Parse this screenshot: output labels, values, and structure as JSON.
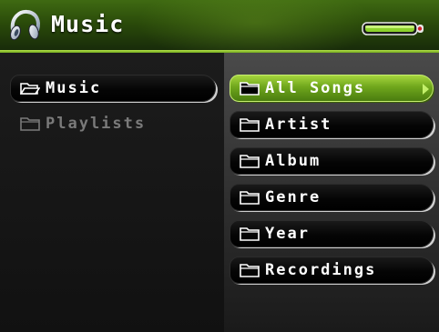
{
  "header": {
    "title": "Music",
    "icon": "headphones-icon",
    "status_icon": "battery-icon",
    "accent_color": "#6fa61c"
  },
  "left_panel": {
    "items": [
      {
        "label": "Music",
        "icon": "folder-open-icon",
        "active": true
      },
      {
        "label": "Playlists",
        "icon": "folder-icon",
        "active": false
      }
    ]
  },
  "right_panel": {
    "items": [
      {
        "label": "All Songs",
        "icon": "folder-icon",
        "selected": true
      },
      {
        "label": "Artist",
        "icon": "folder-icon",
        "selected": false
      },
      {
        "label": "Album",
        "icon": "folder-icon",
        "selected": false
      },
      {
        "label": "Genre",
        "icon": "folder-icon",
        "selected": false
      },
      {
        "label": "Year",
        "icon": "folder-icon",
        "selected": false
      },
      {
        "label": "Recordings",
        "icon": "folder-icon",
        "selected": false
      }
    ]
  }
}
